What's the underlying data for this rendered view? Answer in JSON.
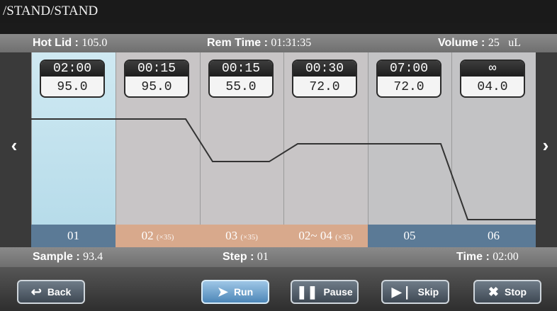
{
  "title": "/STAND/STAND",
  "status": {
    "hot_lid_label": "Hot Lid :",
    "hot_lid_value": "105.0",
    "rem_time_label": "Rem Time :",
    "rem_time_value": "01:31:35",
    "volume_label": "Volume :",
    "volume_value": "25",
    "volume_unit": "uL"
  },
  "steps": [
    {
      "time": "02:00",
      "temp": "95.0",
      "label": "01",
      "cycles": "",
      "color": "#5b7a96"
    },
    {
      "time": "00:15",
      "temp": "95.0",
      "label": "02",
      "cycles": "(×35)",
      "color": "#d8a98c"
    },
    {
      "time": "00:15",
      "temp": "55.0",
      "label": "03",
      "cycles": "(×35)",
      "color": "#d8a98c"
    },
    {
      "time": "00:30",
      "temp": "72.0",
      "label": "02~ 04",
      "cycles": "(×35)",
      "color": "#d8a98c"
    },
    {
      "time": "07:00",
      "temp": "72.0",
      "label": "05",
      "cycles": "",
      "color": "#5b7a96"
    },
    {
      "time": "∞",
      "temp": "04.0",
      "label": "06",
      "cycles": "",
      "color": "#5b7a96"
    }
  ],
  "current": {
    "sample_label": "Sample :",
    "sample_value": "93.4",
    "step_label": "Step :",
    "step_value": "01",
    "time_label": "Time :",
    "time_value": "02:00"
  },
  "buttons": {
    "back": "Back",
    "run": "Run",
    "pause": "Pause",
    "skip": "Skip",
    "stop": "Stop"
  }
}
